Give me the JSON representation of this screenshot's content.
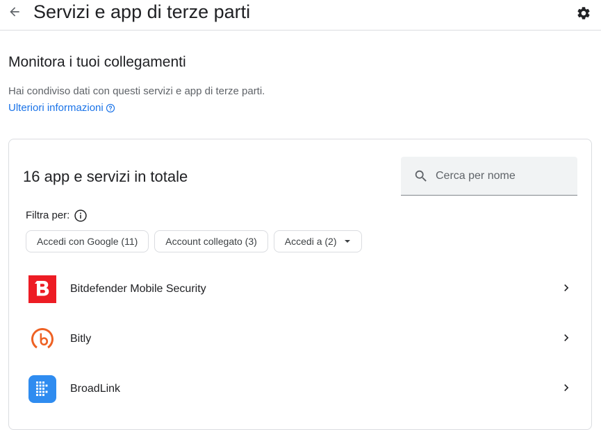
{
  "header": {
    "title": "Servizi e app di terze parti"
  },
  "section": {
    "heading": "Monitora i tuoi collegamenti",
    "description": "Hai condiviso dati con questi servizi e app di terze parti.",
    "learn_more": "Ulteriori informazioni"
  },
  "card": {
    "title": "16 app e servizi in totale",
    "search": {
      "placeholder": "Cerca per nome",
      "value": ""
    },
    "filter_label": "Filtra per:",
    "chips": [
      {
        "label": "Accedi con Google (11)"
      },
      {
        "label": "Account collegato (3)"
      },
      {
        "label": "Accedi a (2)",
        "has_dropdown": true
      }
    ],
    "apps": [
      {
        "name": "Bitdefender Mobile Security",
        "logo": "bitdefender-logo",
        "color": "#ed1c24"
      },
      {
        "name": "Bitly",
        "logo": "bitly-logo",
        "color": "#ee6123"
      },
      {
        "name": "BroadLink",
        "logo": "broadlink-logo",
        "color": "#2f8cf0"
      }
    ]
  },
  "colors": {
    "accent": "#1a73e8",
    "text_primary": "#202124",
    "text_secondary": "#5f6368",
    "border": "#dadce0",
    "search_bg": "#f1f3f4"
  }
}
